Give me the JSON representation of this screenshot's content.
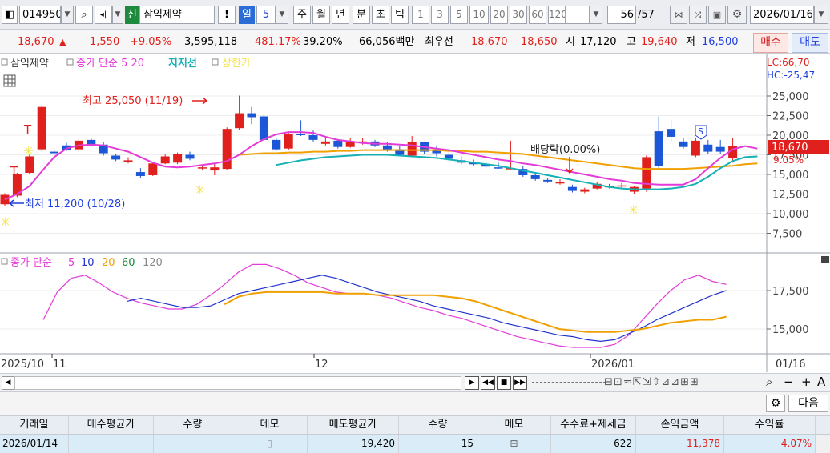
{
  "toolbar": {
    "stock_code": "014950",
    "market_badge": "신",
    "stock_name": "삼익제약",
    "period_num": "5",
    "tabs": {
      "min_tick": "일",
      "week": "주",
      "month": "월",
      "year": "년",
      "minute": "분",
      "second": "초",
      "tick": "틱"
    },
    "timeframes": [
      "1",
      "3",
      "5",
      "10",
      "20",
      "30",
      "60",
      "120"
    ],
    "count_value": "56",
    "count_total": "/57",
    "date": "2026/01/16"
  },
  "quote": {
    "price": "18,670",
    "change": "1,550",
    "change_pct": "+9.05%",
    "volume": "3,595,118",
    "volume_ratio": "481.17%",
    "turnover": "39.20%",
    "amount": "66,056백만",
    "best_quote_label": "최우선",
    "ask": "18,670",
    "bid": "18,650",
    "open_label": "시",
    "open": "17,120",
    "high_label": "고",
    "high": "19,640",
    "low_label": "저",
    "low": "16,500",
    "buy_label": "매수",
    "sell_label": "매도"
  },
  "chart_data": [
    {
      "type": "candlestick",
      "legend": {
        "name": "삼익제약",
        "ma": "종가 단순 5 20",
        "support": "지지선",
        "limit": "상한가"
      },
      "lc_label": "LC:66,70",
      "hc_label": "HC:-25,47",
      "y_ticks": [
        "25,000",
        "22,500",
        "20,000",
        "17,500",
        "15,000",
        "12,500",
        "10,000",
        "7,500"
      ],
      "ylim": [
        5500,
        28500
      ],
      "current_price_label": "18,670",
      "current_pct_label": "9.05%",
      "annotations": {
        "high": "최고 25,050 (11/19)",
        "low": "최저 11,200 (10/28)",
        "dividend": "배당락(0.00%)",
        "s_marker": "S"
      },
      "candles": [
        [
          11200,
          12600,
          11000,
          12400
        ],
        [
          12300,
          15200,
          12100,
          15000
        ],
        [
          15200,
          17500,
          15000,
          17300
        ],
        [
          18200,
          23800,
          18000,
          23600
        ],
        [
          17900,
          18300,
          17500,
          17700
        ],
        [
          18700,
          19000,
          18000,
          18100
        ],
        [
          18200,
          19700,
          17900,
          19300
        ],
        [
          19400,
          19700,
          18500,
          18700
        ],
        [
          18800,
          19100,
          17400,
          17700
        ],
        [
          17400,
          17600,
          16700,
          16900
        ],
        [
          16600,
          17200,
          16400,
          16800
        ],
        [
          15300,
          15800,
          14500,
          14800
        ],
        [
          14900,
          16600,
          14800,
          16400
        ],
        [
          16400,
          17600,
          16300,
          17300
        ],
        [
          16500,
          17800,
          16300,
          17600
        ],
        [
          17500,
          17900,
          16800,
          17000
        ],
        [
          15800,
          16200,
          15500,
          15900
        ],
        [
          15500,
          16300,
          14900,
          15900
        ],
        [
          15700,
          21000,
          15600,
          20800
        ],
        [
          20900,
          25050,
          20700,
          22800
        ],
        [
          22800,
          23600,
          21400,
          22300
        ],
        [
          22400,
          22600,
          19200,
          19400
        ],
        [
          19400,
          19600,
          18000,
          18200
        ],
        [
          18300,
          20400,
          18100,
          20100
        ],
        [
          20200,
          21900,
          19900,
          20000
        ],
        [
          20000,
          20600,
          19200,
          19400
        ],
        [
          18900,
          19900,
          18700,
          19200
        ],
        [
          19300,
          19500,
          18300,
          18500
        ],
        [
          18500,
          19600,
          18400,
          19100
        ],
        [
          19000,
          19600,
          18800,
          19200
        ],
        [
          19200,
          19400,
          18500,
          18700
        ],
        [
          18700,
          19100,
          17900,
          18200
        ],
        [
          18200,
          18600,
          17300,
          17500
        ],
        [
          17400,
          19900,
          17200,
          19100
        ],
        [
          19100,
          19200,
          17600,
          17900
        ],
        [
          18100,
          18700,
          17300,
          17700
        ],
        [
          17500,
          17900,
          16900,
          17000
        ],
        [
          16800,
          17300,
          16300,
          16500
        ],
        [
          16500,
          16900,
          16100,
          16300
        ],
        [
          16300,
          16700,
          15800,
          16000
        ],
        [
          15900,
          16500,
          15700,
          15800
        ],
        [
          15700,
          19300,
          15600,
          15800
        ],
        [
          15700,
          16100,
          14700,
          14900
        ],
        [
          14900,
          15300,
          14200,
          14400
        ],
        [
          14300,
          14500,
          13900,
          14100
        ],
        [
          13900,
          14400,
          13700,
          14000
        ],
        [
          13400,
          13700,
          12700,
          12900
        ],
        [
          12800,
          13300,
          12600,
          13100
        ],
        [
          13200,
          14000,
          13100,
          13800
        ],
        [
          13400,
          13800,
          13200,
          13500
        ],
        [
          13500,
          13900,
          13300,
          13600
        ],
        [
          12800,
          13500,
          12500,
          13400
        ],
        [
          13200,
          17400,
          12800,
          17200
        ],
        [
          20500,
          22400,
          15800,
          16100
        ],
        [
          20800,
          22000,
          19200,
          19800
        ],
        [
          19200,
          19700,
          18300,
          18500
        ],
        [
          17400,
          19700,
          17200,
          19300
        ],
        [
          18800,
          19400,
          17600,
          17900
        ],
        [
          18500,
          19400,
          17600,
          17900
        ],
        [
          17120,
          19640,
          16500,
          18670
        ]
      ],
      "ma5": [
        11800,
        12500,
        13500,
        15400,
        17200,
        18300,
        18700,
        18800,
        18700,
        18300,
        17900,
        17200,
        16500,
        16000,
        15900,
        16000,
        16200,
        16400,
        16700,
        17500,
        18600,
        19500,
        20100,
        20400,
        20400,
        20300,
        19800,
        19400,
        19200,
        19000,
        18900,
        18900,
        18800,
        18700,
        18500,
        18300,
        18100,
        17800,
        17500,
        17200,
        16900,
        16700,
        16400,
        16200,
        15900,
        15600,
        15300,
        15000,
        14700,
        14400,
        14200,
        13900,
        13800,
        13700,
        13700,
        13700,
        14400,
        15800,
        17100,
        18200,
        18600,
        18300
      ],
      "ma20": [
        null,
        null,
        null,
        null,
        null,
        null,
        null,
        null,
        null,
        null,
        null,
        null,
        null,
        null,
        null,
        null,
        null,
        null,
        null,
        17500,
        17600,
        17700,
        17700,
        17800,
        17800,
        17900,
        17900,
        18000,
        18000,
        18100,
        18100,
        18100,
        18100,
        18100,
        18100,
        18100,
        18000,
        18000,
        17900,
        17900,
        17800,
        17700,
        17600,
        17400,
        17200,
        17000,
        16800,
        16600,
        16400,
        16200,
        16000,
        15800,
        15700,
        15700,
        15700,
        15700,
        15800,
        15900,
        16000,
        16100,
        16300,
        16400
      ],
      "support": [
        null,
        null,
        null,
        null,
        null,
        null,
        null,
        null,
        null,
        null,
        null,
        null,
        null,
        null,
        null,
        null,
        null,
        null,
        null,
        null,
        null,
        null,
        16200,
        16500,
        16800,
        17000,
        17200,
        17300,
        17400,
        17500,
        17500,
        17500,
        17400,
        17300,
        17200,
        17100,
        16900,
        16700,
        16500,
        16300,
        16100,
        15800,
        15500,
        15200,
        14900,
        14600,
        14300,
        14000,
        13700,
        13400,
        13200,
        13100,
        13100,
        13100,
        13200,
        13400,
        13800,
        14700,
        15800,
        16700,
        17200,
        17300
      ],
      "dates_axis": [
        "2025/10",
        "11",
        "12",
        "2026/01",
        "01/16"
      ]
    },
    {
      "type": "line",
      "legend": {
        "title": "종가 단순",
        "p5": "5",
        "p10": "10",
        "p20": "20",
        "p60": "60",
        "p120": "120"
      },
      "y_ticks": [
        "17,500",
        "15,000"
      ],
      "ylim": [
        13500,
        19800
      ],
      "series": [
        {
          "name": "5",
          "color": "#e33bd8",
          "values": [
            15600,
            17400,
            18300,
            18500,
            18000,
            17400,
            17000,
            16700,
            16500,
            16300,
            16300,
            16600,
            17200,
            17900,
            18700,
            19200,
            19200,
            18900,
            18500,
            18000,
            17700,
            17400,
            17300,
            17300,
            17200,
            17000,
            16700,
            16400,
            16200,
            15900,
            15700,
            15400,
            15100,
            14800,
            14500,
            14300,
            14100,
            13900,
            13800,
            13800,
            13800,
            14000,
            14600,
            15600,
            16600,
            17500,
            18200,
            18500,
            18100,
            17900
          ]
        },
        {
          "name": "10",
          "color": "#2233cc",
          "values": [
            null,
            null,
            null,
            null,
            null,
            null,
            16800,
            17000,
            16800,
            16600,
            16400,
            16400,
            16500,
            16900,
            17300,
            17500,
            17700,
            17900,
            18100,
            18300,
            18500,
            18300,
            18000,
            17700,
            17400,
            17200,
            17000,
            16800,
            16500,
            16300,
            16100,
            15900,
            15700,
            15400,
            15200,
            15000,
            14800,
            14600,
            14500,
            14300,
            14200,
            14300,
            14700,
            15100,
            15600,
            16000,
            16400,
            16800,
            17200,
            17500
          ]
        },
        {
          "name": "20",
          "color": "#f0a000",
          "values": [
            null,
            null,
            null,
            null,
            null,
            null,
            null,
            null,
            null,
            null,
            null,
            null,
            null,
            16600,
            17100,
            17300,
            17400,
            17400,
            17400,
            17400,
            17400,
            17300,
            17300,
            17300,
            17200,
            17200,
            17200,
            17200,
            17200,
            17100,
            17000,
            16800,
            16500,
            16200,
            15900,
            15600,
            15300,
            15000,
            14900,
            14800,
            14800,
            14800,
            14900,
            15000,
            15200,
            15400,
            15500,
            15600,
            15600,
            15800
          ]
        }
      ]
    }
  ],
  "nav": {
    "zoom_minus": "−",
    "zoom_plus": "+",
    "font_label": "A",
    "search_icon": "search-icon"
  },
  "table": {
    "next_label": "다음",
    "headers": [
      "거래일",
      "매수평균가",
      "수량",
      "메모",
      "매도평균가",
      "수량",
      "메모",
      "수수료+제세금",
      "손익금액",
      "수익률"
    ],
    "rows": [
      {
        "date": "2026/01/14",
        "buy_avg": "",
        "buy_qty": "",
        "buy_memo": "",
        "sell_avg": "19,420",
        "sell_qty": "15",
        "sell_memo": "",
        "fee": "622",
        "pnl": "11,378",
        "ret": "4.07%"
      }
    ]
  },
  "colors": {
    "up": "#e0201d",
    "down": "#1b57d6",
    "ma5": "#e33bd8",
    "ma20": "#f0a000",
    "support": "#16b0b5"
  }
}
